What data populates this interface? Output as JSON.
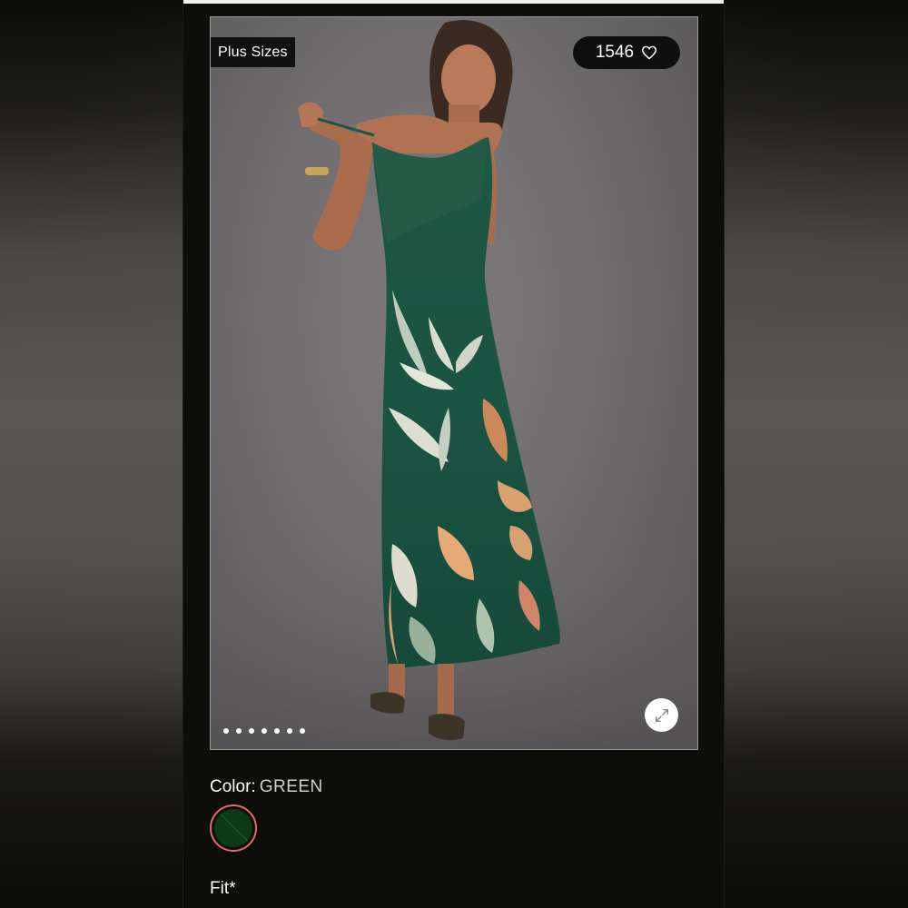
{
  "product": {
    "badge": "Plus Sizes",
    "like_count": "1546",
    "image_dot_count": 7,
    "color_label": "Color:",
    "color_value": "GREEN",
    "swatch_color": "#0d3a14",
    "fit_label": "Fit*"
  },
  "icons": {
    "like": "heart-icon",
    "expand": "expand-arrows-icon"
  },
  "colors": {
    "background": "#0d0e0a",
    "swatch_ring": "#e46a6a",
    "dress_green": "#1c5a44"
  }
}
